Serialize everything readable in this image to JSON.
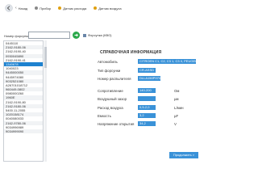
{
  "toolbar": {
    "back_label": "Назад",
    "items": [
      {
        "label": "Прибор",
        "color": "#888888"
      },
      {
        "label": "Датчик расхода",
        "color": "#e0a010"
      },
      {
        "label": "Датчик воздуха",
        "color": "#e0a010"
      }
    ]
  },
  "search": {
    "label": "Номер форсунки",
    "value": "",
    "placeholder": ""
  },
  "tab_toggle": {
    "label": "Форсунка (КВО)"
  },
  "list": {
    "items": [
      "0445110",
      "2162-9180-06",
      "2162-9190-40",
      "0930045890",
      "2162-9190-41",
      "1340678",
      "1040023",
      "9445000050",
      "9445974080",
      "9032521080",
      "A26701018712",
      "960449-0802",
      "0980000260",
      "1960E",
      "2162-9190-80",
      "2162-9180-06",
      "5400.11-2055",
      "1020158174",
      "0040080033",
      "2162-9780-06",
      "9034996989",
      "9034999090"
    ],
    "selected_index": 5
  },
  "reference": {
    "title": "СПРАВОЧНАЯ ИНФОРМАЦИЯ",
    "fields": [
      {
        "label": "Автомобиль",
        "value": "CITROEN C1, C2, C3 1, C3 II, PEUGEOT..",
        "unit": ""
      },
      {
        "label": "Тип форсунки",
        "value": "CR-ASSD",
        "unit": ""
      },
      {
        "label": "Номер распылителя",
        "value": "DLLA150P970",
        "unit": ""
      },
      {
        "label": "Сопротивление",
        "value": "140-200",
        "unit": "Ом"
      },
      {
        "label": "Воздушный зазор",
        "value": "",
        "unit": "µм"
      },
      {
        "label": "Расход воздуха",
        "value": "0,5-2,0",
        "unit": "L/мин"
      },
      {
        "label": "Емкость",
        "value": "3,2",
        "unit": "µF"
      },
      {
        "label": "Напряжение открытия",
        "value": "34,2",
        "unit": "V"
      }
    ]
  },
  "continue_label": "Продолжить >",
  "colors": {
    "accent": "#3a92d8",
    "selected": "#1e82cf",
    "search_go": "#2aa84a"
  }
}
